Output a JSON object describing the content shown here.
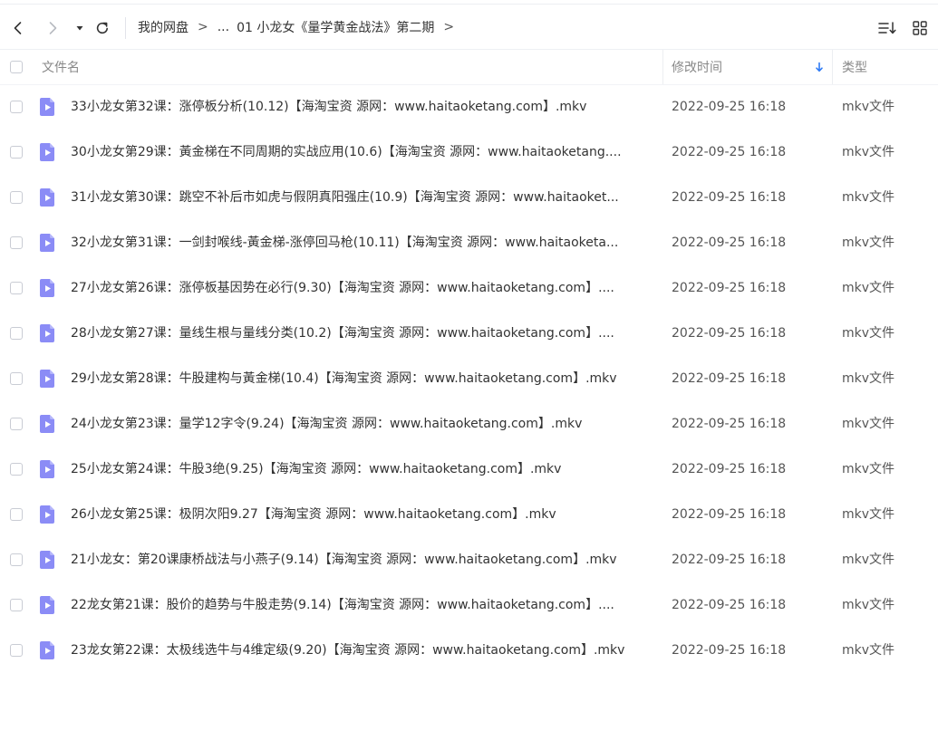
{
  "breadcrumb": {
    "items": [
      "我的网盘",
      "...",
      "01 小龙女《量学黄金战法》第二期"
    ],
    "separator": ">"
  },
  "icons": {
    "back": "chevron-left-icon",
    "forward": "chevron-right-icon",
    "history": "caret-down-icon",
    "refresh": "refresh-icon",
    "sort": "sort-list-icon",
    "view": "grid-view-icon",
    "file": "video-file-icon"
  },
  "colors": {
    "accent": "#2f7bf5",
    "file_icon": "#8b8cf6"
  },
  "table": {
    "columns": {
      "name": "文件名",
      "modified": "修改时间",
      "type": "类型"
    },
    "sort_column": "modified",
    "sort_direction": "desc",
    "rows": [
      {
        "name": "33小龙女第32课：涨停板分析(10.12)【海淘宝资 源网：www.haitaoketang.com】.mkv",
        "modified": "2022-09-25 16:18",
        "type": "mkv文件"
      },
      {
        "name": "30小龙女第29课：黃金梯在不同周期的实战应用(10.6)【海淘宝资 源网：www.haitaoketang....",
        "modified": "2022-09-25 16:18",
        "type": "mkv文件"
      },
      {
        "name": "31小龙女第30课：跳空不补后市如虎与假阴真阳强庄(10.9)【海淘宝资 源网：www.haitaoket...",
        "modified": "2022-09-25 16:18",
        "type": "mkv文件"
      },
      {
        "name": "32小龙女第31课：一剑封喉线-黃金梯-涨停回马枪(10.11)【海淘宝资 源网：www.haitaoketa...",
        "modified": "2022-09-25 16:18",
        "type": "mkv文件"
      },
      {
        "name": "27小龙女第26课：涨停板基因势在必行(9.30)【海淘宝资 源网：www.haitaoketang.com】....",
        "modified": "2022-09-25 16:18",
        "type": "mkv文件"
      },
      {
        "name": "28小龙女第27课：量线生根与量线分类(10.2)【海淘宝资 源网：www.haitaoketang.com】....",
        "modified": "2022-09-25 16:18",
        "type": "mkv文件"
      },
      {
        "name": "29小龙女第28课：牛股建构与黃金梯(10.4)【海淘宝资 源网：www.haitaoketang.com】.mkv",
        "modified": "2022-09-25 16:18",
        "type": "mkv文件"
      },
      {
        "name": "24小龙女第23课：量学12字令(9.24)【海淘宝资 源网：www.haitaoketang.com】.mkv",
        "modified": "2022-09-25 16:18",
        "type": "mkv文件"
      },
      {
        "name": "25小龙女第24课：牛股3绝(9.25)【海淘宝资 源网：www.haitaoketang.com】.mkv",
        "modified": "2022-09-25 16:18",
        "type": "mkv文件"
      },
      {
        "name": "26小龙女第25课：极阴次阳9.27【海淘宝资 源网：www.haitaoketang.com】.mkv",
        "modified": "2022-09-25 16:18",
        "type": "mkv文件"
      },
      {
        "name": "21小龙女：第20课康桥战法与小燕子(9.14)【海淘宝资 源网：www.haitaoketang.com】.mkv",
        "modified": "2022-09-25 16:18",
        "type": "mkv文件"
      },
      {
        "name": "22龙女第21课：股价的趋势与牛股走势(9.14)【海淘宝资 源网：www.haitaoketang.com】....",
        "modified": "2022-09-25 16:18",
        "type": "mkv文件"
      },
      {
        "name": "23龙女第22课：太极线选牛与4维定级(9.20)【海淘宝资 源网：www.haitaoketang.com】.mkv",
        "modified": "2022-09-25 16:18",
        "type": "mkv文件"
      }
    ]
  }
}
